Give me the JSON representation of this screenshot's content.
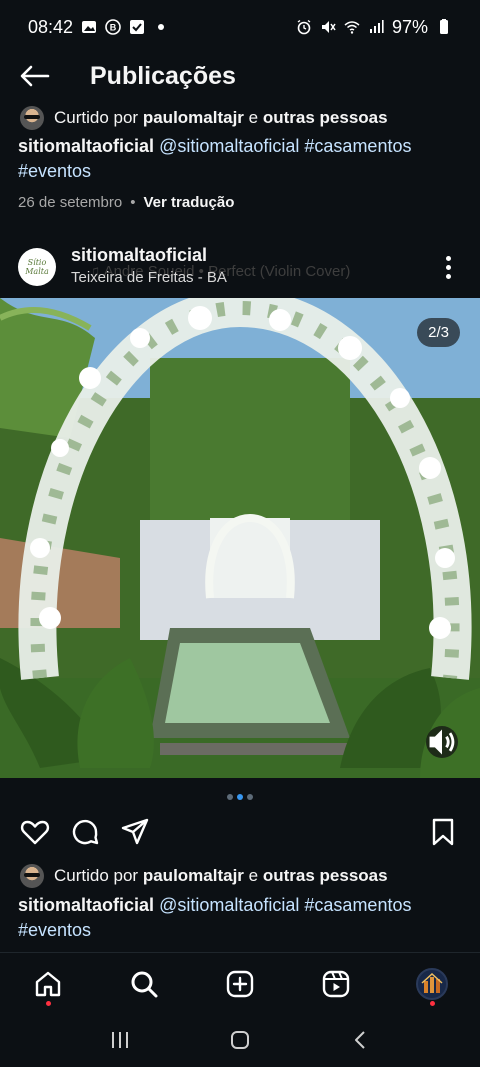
{
  "status_bar": {
    "time": "08:42",
    "left_icons": [
      "gallery-icon",
      "bixby-icon",
      "check-box-icon",
      "dot-icon"
    ],
    "right_icons": [
      "alarm-icon",
      "mute-icon",
      "wifi-icon",
      "signal-icon"
    ],
    "battery": "97%"
  },
  "header": {
    "title": "Publicações"
  },
  "previous_post": {
    "liked_prefix": "Curtido por",
    "liked_user": "paulomaltajr",
    "liked_conj": "e",
    "liked_suffix": "outras pessoas",
    "caption_user": "sitiomaltaoficial",
    "caption_tags": [
      "@sitiomaltaoficial",
      "#casamentos",
      "#eventos"
    ],
    "date": "26 de setembro",
    "separator": "•",
    "translate": "Ver tradução"
  },
  "post": {
    "username": "sitiomaltaoficial",
    "music": "♫ Andre Soueid • Perfect (Violin Cover)",
    "location": "Teixeira de Freitas - BA",
    "page_indicator": "2/3",
    "carousel": {
      "count": 3,
      "active": 2
    },
    "liked_prefix": "Curtido por",
    "liked_user": "paulomaltajr",
    "liked_conj": "e",
    "liked_suffix": "outras pessoas",
    "caption_user": "sitiomaltaoficial",
    "caption_tags": [
      "@sitiomaltaoficial",
      "#casamentos",
      "#eventos"
    ],
    "avatar_logo_text": "Sítio Malta"
  },
  "nav": {
    "items": [
      "home-icon",
      "search-icon",
      "create-icon",
      "reels-icon",
      "profile-avatar"
    ]
  },
  "colors": {
    "background": "#0c1014",
    "accent": "#3897f0",
    "notification": "#ff3040",
    "hashtag": "#c6e3ff"
  }
}
